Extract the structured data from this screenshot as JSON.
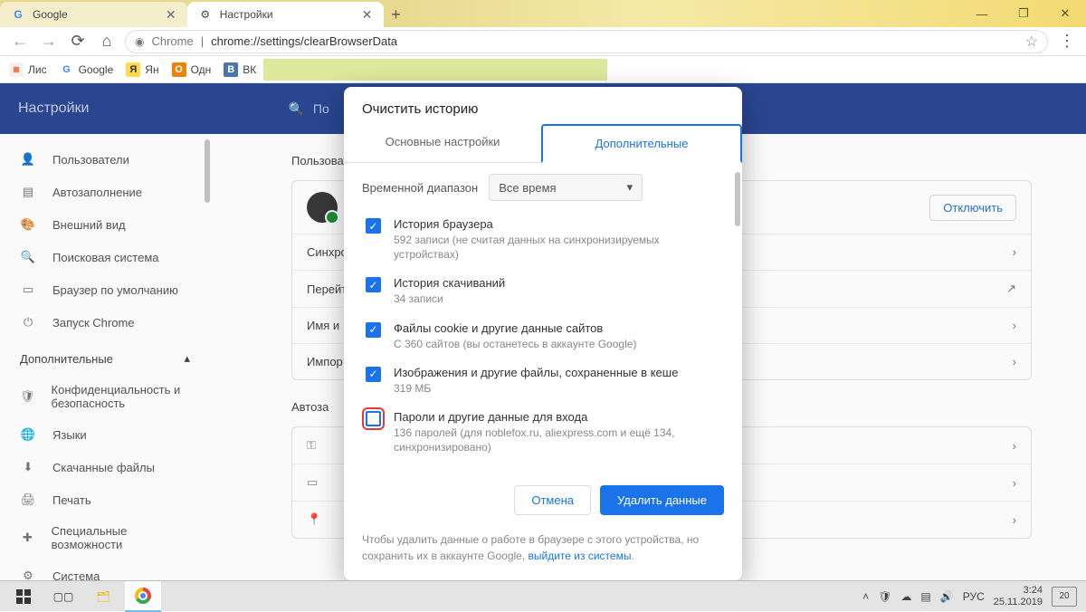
{
  "tabs": [
    {
      "title": "Google",
      "favicon": "G"
    },
    {
      "title": "Настройки",
      "favicon": "⚙"
    }
  ],
  "addressbar": {
    "protocol": "Chrome",
    "url": "chrome://settings/clearBrowserData"
  },
  "bookmarks": [
    {
      "name": "Лис"
    },
    {
      "name": "Google"
    },
    {
      "name": "Ян"
    },
    {
      "name": "Одн"
    },
    {
      "name": "ВК"
    }
  ],
  "settings": {
    "title": "Настройки",
    "search_placeholder": "По",
    "sidebar": [
      {
        "icon": "👤",
        "label": "Пользователи"
      },
      {
        "icon": "▤",
        "label": "Автозаполнение"
      },
      {
        "icon": "🎨",
        "label": "Внешний вид"
      },
      {
        "icon": "🔍",
        "label": "Поисковая система"
      },
      {
        "icon": "▭",
        "label": "Браузер по умолчанию"
      },
      {
        "icon": "⏻",
        "label": "Запуск Chrome"
      }
    ],
    "expand_label": "Дополнительные",
    "sidebar2": [
      {
        "icon": "🛡",
        "label": "Конфиденциальность и безопасность"
      },
      {
        "icon": "🌐",
        "label": "Языки"
      },
      {
        "icon": "⬇",
        "label": "Скачанные файлы"
      },
      {
        "icon": "🖨",
        "label": "Печать"
      },
      {
        "icon": "✚",
        "label": "Специальные возможности"
      },
      {
        "icon": "⚙",
        "label": "Система"
      }
    ],
    "sections": {
      "users_title": "Пользователи",
      "disconnect": "Отключить",
      "rows": [
        "Синхро",
        "Перейт",
        "Имя и",
        "Импор"
      ],
      "autofill_title": "Автоза",
      "autofill_rows": [
        "⚿",
        "▭",
        "📍"
      ]
    }
  },
  "dialog": {
    "title": "Очистить историю",
    "tab_basic": "Основные настройки",
    "tab_advanced": "Дополнительные",
    "timerange_label": "Временной диапазон",
    "timerange_value": "Все время",
    "items": [
      {
        "checked": true,
        "title": "История браузера",
        "sub": "592 записи (не считая данных на синхронизируемых устройствах)"
      },
      {
        "checked": true,
        "title": "История скачиваний",
        "sub": "34 записи"
      },
      {
        "checked": true,
        "title": "Файлы cookie и другие данные сайтов",
        "sub": "С 360 сайтов (вы останетесь в аккаунте Google)"
      },
      {
        "checked": true,
        "title": "Изображения и другие файлы, сохраненные в кеше",
        "sub": "319 МБ"
      },
      {
        "checked": false,
        "highlight": true,
        "title": "Пароли и другие данные для входа",
        "sub": "136 паролей (для noblefox.ru, aliexpress.com и ещё 134, синхронизировано)"
      }
    ],
    "cancel": "Отмена",
    "confirm": "Удалить данные",
    "note_pre": "Чтобы удалить данные о работе в браузере с этого устройства, но сохранить их в аккаунте Google, ",
    "note_link": "выйдите из системы",
    "note_post": "."
  },
  "taskbar": {
    "lang": "РУС",
    "time": "3:24",
    "date": "25.11.2019",
    "notif": "20"
  }
}
